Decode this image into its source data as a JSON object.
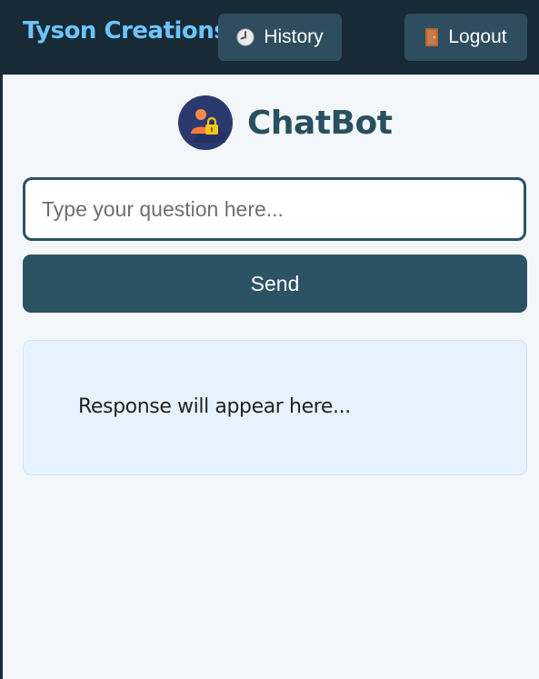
{
  "header": {
    "brand": "Tyson Creations",
    "history_label": "History",
    "history_icon": "clock-icon",
    "logout_label": "Logout",
    "logout_icon": "door-icon"
  },
  "main": {
    "title": "ChatBot",
    "logo_icon": "user-lock-icon",
    "input_placeholder": "Type your question here...",
    "send_label": "Send",
    "response_placeholder": "Response will appear here..."
  },
  "colors": {
    "header_bg": "#182a36",
    "brand": "#6cc4ff",
    "button_bg": "#2e4d5e",
    "primary": "#2c5364",
    "page_bg": "#f3f7fa",
    "response_bg": "#e6f3fe"
  }
}
